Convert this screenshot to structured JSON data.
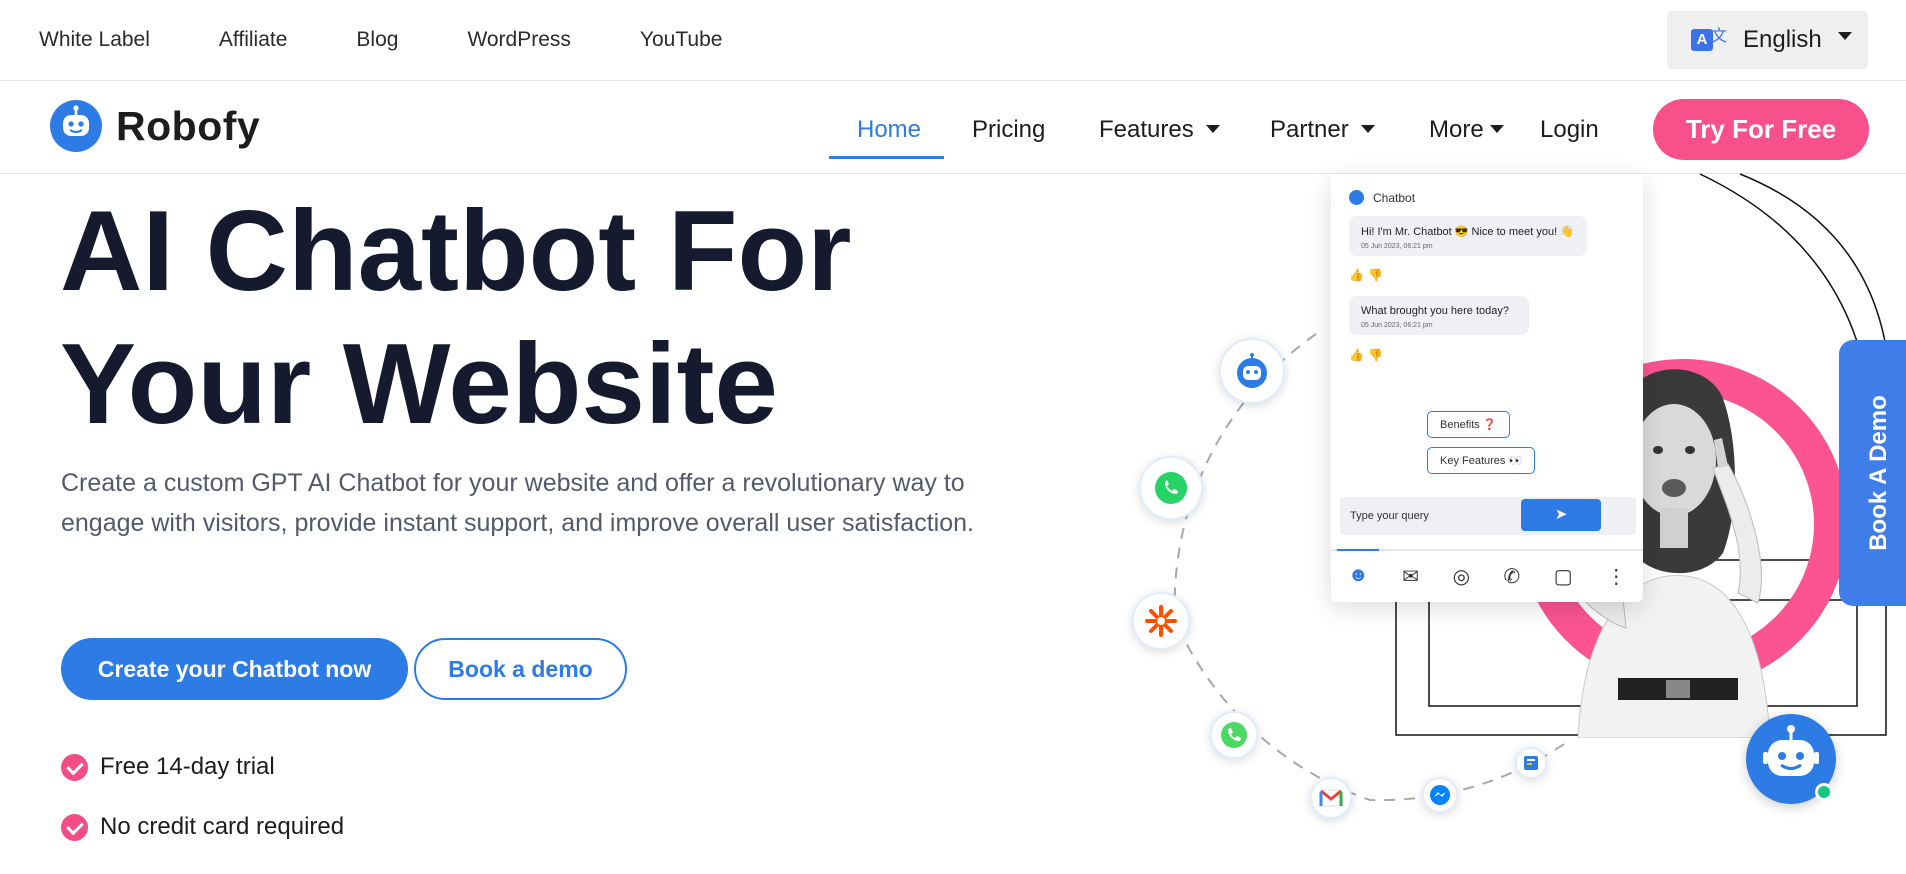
{
  "top_links": [
    "White Label",
    "Affiliate",
    "Blog",
    "WordPress",
    "YouTube"
  ],
  "language": {
    "label": "English"
  },
  "brand": {
    "name": "Robofy"
  },
  "nav": {
    "home": "Home",
    "pricing": "Pricing",
    "features": "Features",
    "partner": "Partner",
    "more": "More",
    "login": "Login",
    "cta": "Try For Free"
  },
  "hero": {
    "title_line1": "AI Chatbot For",
    "title_line2": "Your Website",
    "description": "Create a custom GPT AI Chatbot for your website and offer a revolutionary way to engage with visitors, provide instant support, and improve overall user satisfaction.",
    "primary_button": "Create your Chatbot now",
    "secondary_button": "Book a demo",
    "features": [
      "Free 14-day trial",
      "No credit card required"
    ]
  },
  "chat_preview": {
    "header": "Chatbot",
    "messages": [
      {
        "text": "Hi! I'm Mr. Chatbot 😎 Nice to meet you! 👋",
        "time": "05 Jun 2023, 06:21 pm"
      },
      {
        "text": "What brought you here today?",
        "time": "05 Jun 2023, 06:21 pm"
      }
    ],
    "chips": [
      "Benefits ❓",
      "Key Features 👀"
    ],
    "input_placeholder": "Type your query"
  },
  "side_tab": "Book A Demo",
  "icons": {
    "orbit": [
      "robot-icon",
      "whatsapp-icon",
      "zapier-icon",
      "phone-icon",
      "gmail-icon",
      "messenger-icon",
      "form-icon"
    ],
    "accent": "#2d7be5",
    "brand_pink": "#f7508b"
  }
}
